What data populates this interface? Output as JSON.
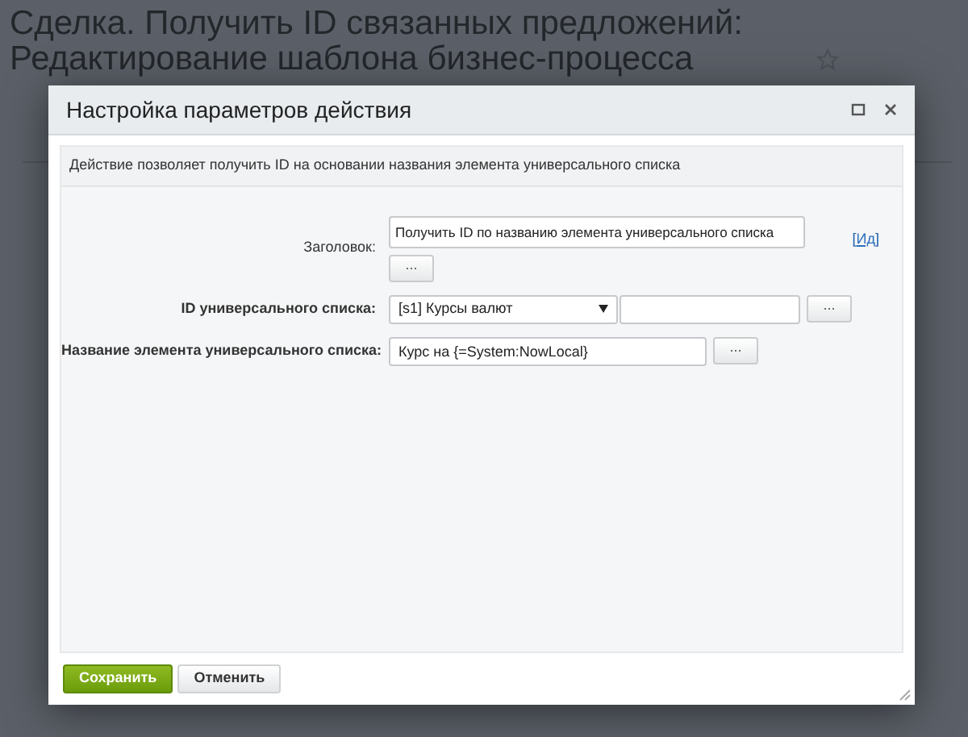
{
  "page": {
    "title": "Сделка. Получить ID связанных предложений: Редактирование шаблона бизнес-процесса"
  },
  "dialog": {
    "title": "Настройка параметров действия",
    "description": "Действие позволяет получить ID на основании названия элемента универсального списка",
    "fields": [
      {
        "kind": "title",
        "label": "Заголовок:",
        "value": "Получить ID по названию элемента универсального списка",
        "button": "...",
        "id_link": {
          "open": "[",
          "label": "Ид",
          "close": "]"
        }
      },
      {
        "kind": "select",
        "label": "ID универсального списка:",
        "value": "[s1] Курсы валют",
        "button": "..."
      },
      {
        "kind": "text",
        "label": "Название элемента универсального списка:",
        "value": "Курс на {=System:NowLocal}",
        "button": "..."
      }
    ],
    "buttons": [
      {
        "label": "Сохранить",
        "kind": "primary"
      },
      {
        "label": "Отменить",
        "kind": "secondary"
      }
    ]
  }
}
